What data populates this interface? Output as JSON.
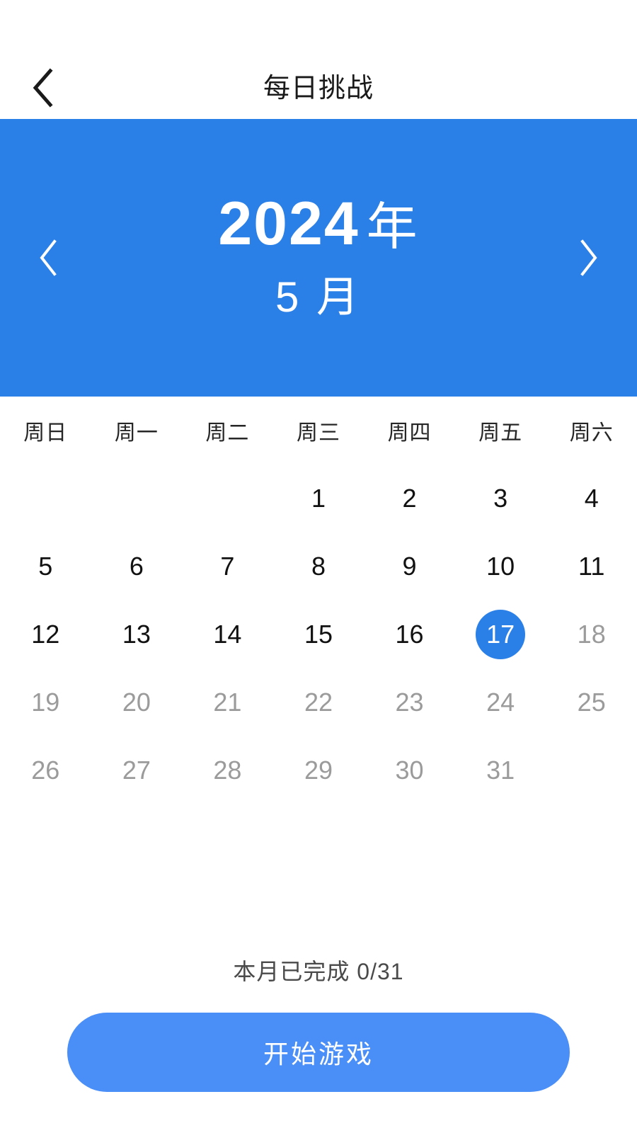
{
  "header": {
    "back_icon": "chevron-left-icon",
    "title": "每日挑战"
  },
  "banner": {
    "prev_icon": "chevron-left-icon",
    "next_icon": "chevron-right-icon",
    "year": "2024",
    "year_unit": "年",
    "month": "5 月",
    "background_color": "#2b80e8"
  },
  "calendar": {
    "weekdays": [
      "周日",
      "周一",
      "周二",
      "周三",
      "周四",
      "周五",
      "周六"
    ],
    "leading_blanks": 3,
    "days": [
      {
        "n": "1",
        "state": "past"
      },
      {
        "n": "2",
        "state": "past"
      },
      {
        "n": "3",
        "state": "past"
      },
      {
        "n": "4",
        "state": "past"
      },
      {
        "n": "5",
        "state": "past"
      },
      {
        "n": "6",
        "state": "past"
      },
      {
        "n": "7",
        "state": "past"
      },
      {
        "n": "8",
        "state": "past"
      },
      {
        "n": "9",
        "state": "past"
      },
      {
        "n": "10",
        "state": "past"
      },
      {
        "n": "11",
        "state": "past"
      },
      {
        "n": "12",
        "state": "past"
      },
      {
        "n": "13",
        "state": "past"
      },
      {
        "n": "14",
        "state": "past"
      },
      {
        "n": "15",
        "state": "past"
      },
      {
        "n": "16",
        "state": "past"
      },
      {
        "n": "17",
        "state": "today"
      },
      {
        "n": "18",
        "state": "future"
      },
      {
        "n": "19",
        "state": "future"
      },
      {
        "n": "20",
        "state": "future"
      },
      {
        "n": "21",
        "state": "future"
      },
      {
        "n": "22",
        "state": "future"
      },
      {
        "n": "23",
        "state": "future"
      },
      {
        "n": "24",
        "state": "future"
      },
      {
        "n": "25",
        "state": "future"
      },
      {
        "n": "26",
        "state": "future"
      },
      {
        "n": "27",
        "state": "future"
      },
      {
        "n": "28",
        "state": "future"
      },
      {
        "n": "29",
        "state": "future"
      },
      {
        "n": "30",
        "state": "future"
      },
      {
        "n": "31",
        "state": "future"
      }
    ],
    "today_highlight_color": "#2b80e8"
  },
  "footer": {
    "progress_text": "本月已完成 0/31",
    "start_button_label": "开始游戏",
    "start_button_color": "#4a8ef8"
  }
}
